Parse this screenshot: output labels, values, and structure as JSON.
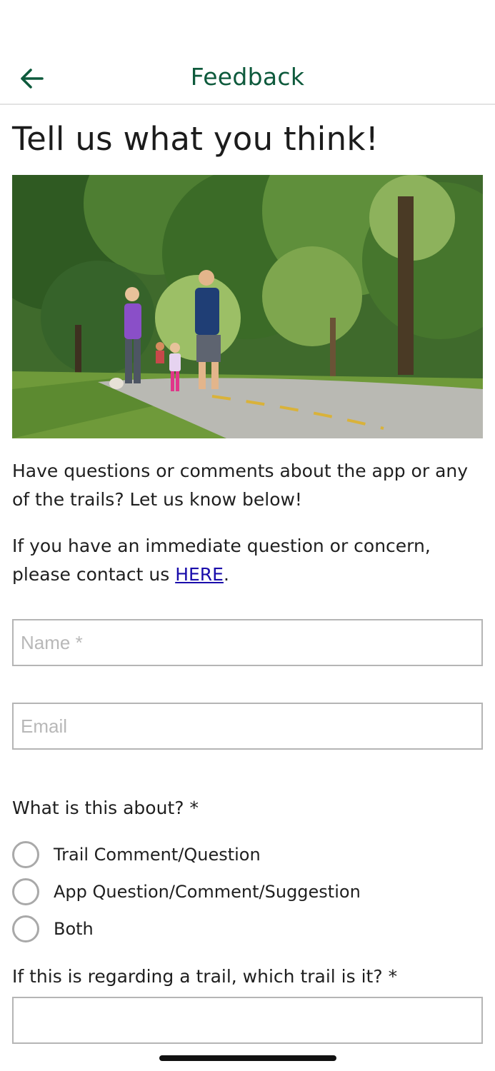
{
  "header": {
    "title": "Feedback",
    "back_icon": "arrow-left-icon",
    "accent_color": "#0e5a3c"
  },
  "page": {
    "heading": "Tell us what you think!",
    "intro": "Have questions or comments about the app or any of the trails? Let us know below!",
    "contact_text": "If you have an immediate question or concern, please contact us ",
    "contact_link": "HERE",
    "contact_suffix": "."
  },
  "form": {
    "name_placeholder": "Name *",
    "name_value": "",
    "email_placeholder": "Email",
    "email_value": "",
    "about_question": "What is this about? *",
    "about_options": [
      "Trail Comment/Question",
      "App Question/Comment/Suggestion",
      "Both"
    ],
    "about_selected": null,
    "trail_question": "If this is regarding a trail, which trail is it? *",
    "trail_value": ""
  }
}
